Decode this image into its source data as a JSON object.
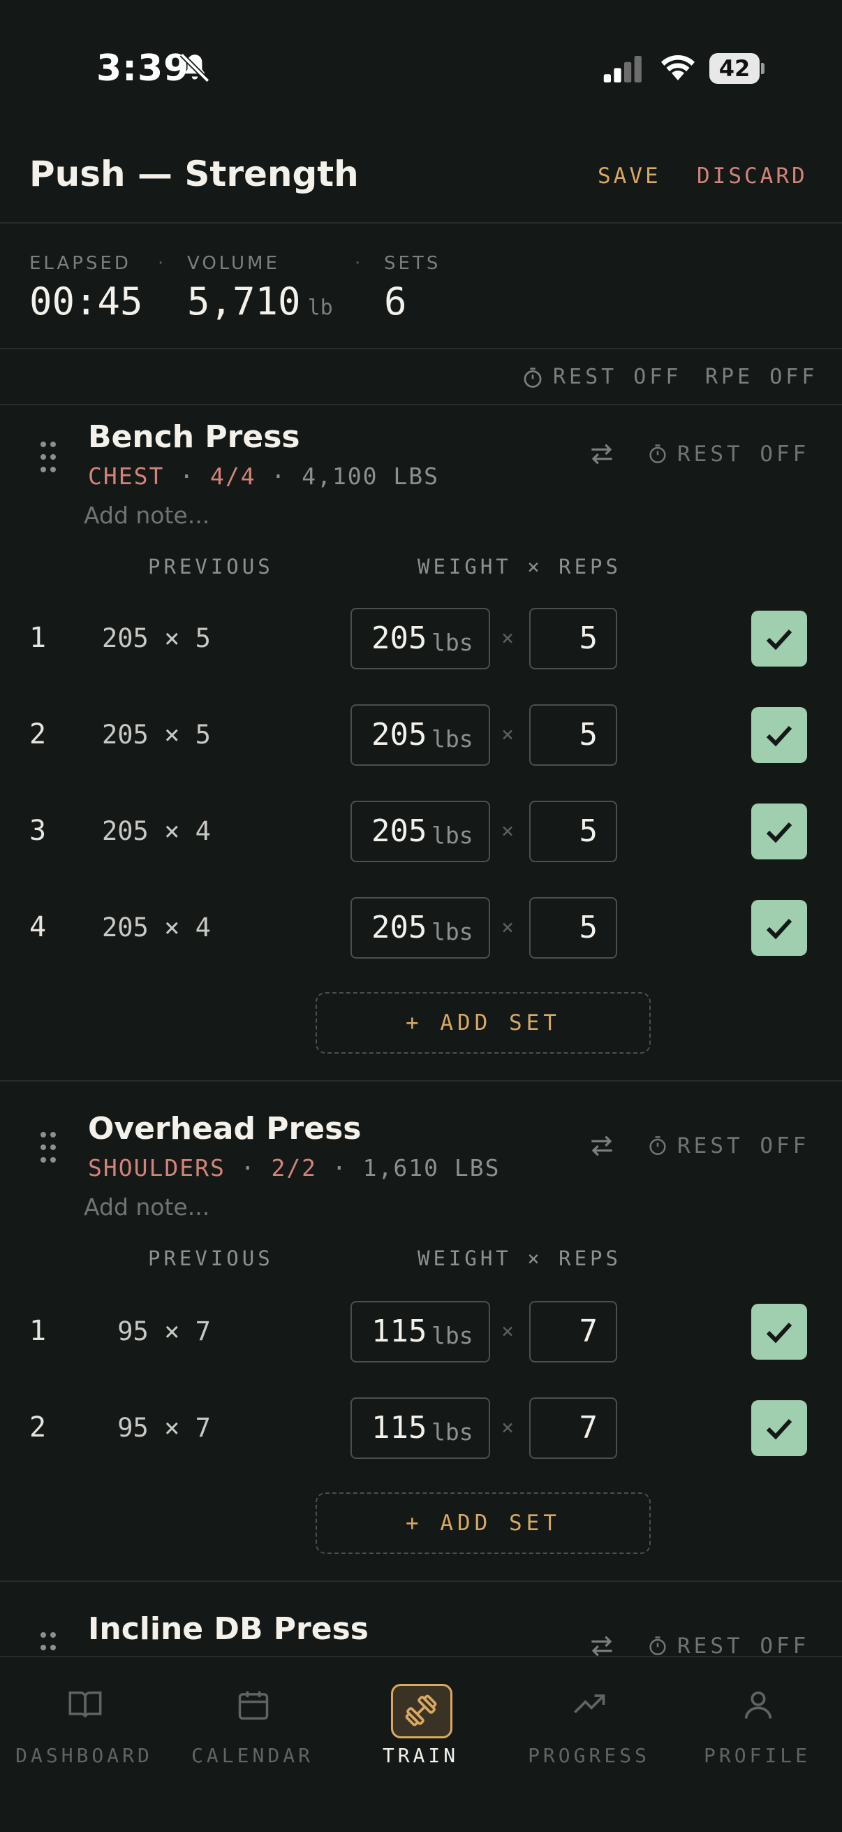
{
  "status_bar": {
    "time": "3:39",
    "battery": "42"
  },
  "header": {
    "title": "Push — Strength",
    "save": "SAVE",
    "discard": "DISCARD"
  },
  "stats": {
    "elapsed_label": "ELAPSED",
    "elapsed": "00:45",
    "volume_label": "VOLUME",
    "volume": "5,710",
    "volume_unit": "lb",
    "sets_label": "SETS",
    "sets": "6",
    "separator": "·"
  },
  "options": {
    "rest": "REST OFF",
    "rpe": "RPE OFF"
  },
  "column_headers": {
    "previous": "PREVIOUS",
    "weight_reps": "WEIGHT × REPS"
  },
  "exercises": [
    {
      "name": "Bench Press",
      "muscle": "CHEST",
      "progress": "4/4",
      "volume": "4,100 LBS",
      "note_placeholder": "Add note...",
      "rest": "REST OFF",
      "add_set": "+ ADD SET",
      "sets": [
        {
          "num": "1",
          "previous": "205 × 5",
          "weight": "205",
          "unit": "lbs",
          "reps": "5",
          "done": true
        },
        {
          "num": "2",
          "previous": "205 × 5",
          "weight": "205",
          "unit": "lbs",
          "reps": "5",
          "done": true
        },
        {
          "num": "3",
          "previous": "205 × 4",
          "weight": "205",
          "unit": "lbs",
          "reps": "5",
          "done": true
        },
        {
          "num": "4",
          "previous": "205 × 4",
          "weight": "205",
          "unit": "lbs",
          "reps": "5",
          "done": true
        }
      ]
    },
    {
      "name": "Overhead Press",
      "muscle": "SHOULDERS",
      "progress": "2/2",
      "volume": "1,610 LBS",
      "note_placeholder": "Add note...",
      "rest": "REST OFF",
      "add_set": "+ ADD SET",
      "sets": [
        {
          "num": "1",
          "previous": " 95 × 7",
          "weight": "115",
          "unit": "lbs",
          "reps": "7",
          "done": true
        },
        {
          "num": "2",
          "previous": " 95 × 7",
          "weight": "115",
          "unit": "lbs",
          "reps": "7",
          "done": true
        }
      ]
    },
    {
      "name": "Incline DB Press",
      "rest": "REST OFF"
    }
  ],
  "times_symbol": "×",
  "sub_sep": "·",
  "nav": [
    {
      "label": "DASHBOARD",
      "icon": "book-icon"
    },
    {
      "label": "CALENDAR",
      "icon": "calendar-icon"
    },
    {
      "label": "TRAIN",
      "icon": "dumbbell-icon",
      "active": true
    },
    {
      "label": "PROGRESS",
      "icon": "trend-icon"
    },
    {
      "label": "PROFILE",
      "icon": "user-icon"
    }
  ],
  "colors": {
    "accent": "#d9a861",
    "danger": "#d4837a",
    "check": "#9fcfae",
    "bg": "#141918"
  }
}
